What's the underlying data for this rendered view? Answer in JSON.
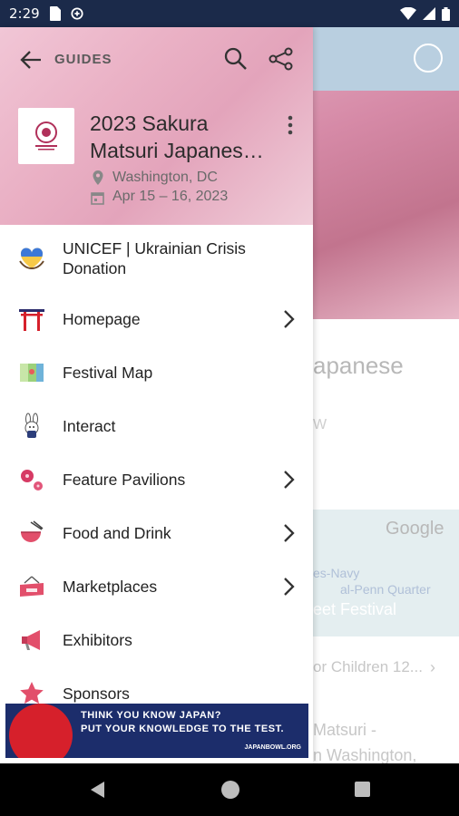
{
  "status_bar": {
    "time": "2:29",
    "icons": [
      "sim-card-icon",
      "data-saver-icon",
      "wifi-icon",
      "signal-icon",
      "battery-icon"
    ]
  },
  "background": {
    "title_fragment": "apanese",
    "subtitle_fragment": "W",
    "map": {
      "google_label": "Google",
      "line1": "es-Navy",
      "line2": "al-Penn Quarter",
      "line3": "eet Festival"
    },
    "row1": "or Children 12...",
    "row2": "Matsuri -",
    "row3": "n Washington,"
  },
  "drawer": {
    "back_label": "GUIDES",
    "event": {
      "title_line1": "2023 Sakura",
      "title_line2": "Matsuri Japanese Street Festival",
      "location": "Washington, DC",
      "dates": "Apr 15 – 16, 2023"
    },
    "menu": [
      {
        "label": "UNICEF | Ukrainian Crisis Donation",
        "icon": "ukraine-heart-icon",
        "chevron": false
      },
      {
        "label": "Homepage",
        "icon": "torii-gate-icon",
        "chevron": true
      },
      {
        "label": "Festival Map",
        "icon": "map-icon",
        "chevron": false
      },
      {
        "label": "Interact",
        "icon": "bunny-mascot-icon",
        "chevron": false
      },
      {
        "label": "Feature Pavilions",
        "icon": "cherry-blossom-icon",
        "chevron": true
      },
      {
        "label": "Food and Drink",
        "icon": "ramen-bowl-icon",
        "chevron": true
      },
      {
        "label": "Marketplaces",
        "icon": "shop-sign-icon",
        "chevron": true
      },
      {
        "label": "Exhibitors",
        "icon": "megaphone-icon",
        "chevron": false
      },
      {
        "label": "Sponsors",
        "icon": "star-icon",
        "chevron": false
      }
    ]
  },
  "ad": {
    "line1": "THINK YOU KNOW JAPAN?",
    "line2": "PUT YOUR KNOWLEDGE TO THE TEST.",
    "site": "JAPANBOWL.ORG"
  },
  "colors": {
    "status_bar": "#1b2a4a",
    "header_pink": "#eab1c5",
    "ad_navy": "#1c2d6b",
    "ad_red": "#d6202b"
  }
}
